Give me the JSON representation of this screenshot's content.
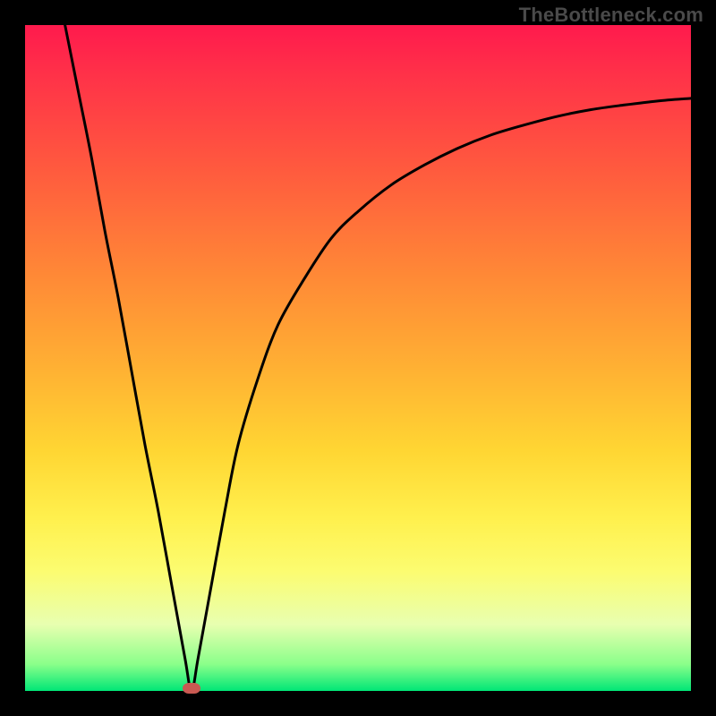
{
  "watermark": "TheBottleneck.com",
  "chart_data": {
    "type": "line",
    "title": "",
    "xlabel": "",
    "ylabel": "",
    "xlim": [
      0,
      100
    ],
    "ylim": [
      0,
      100
    ],
    "x": [
      6,
      8,
      10,
      12,
      14,
      16,
      18,
      20,
      22,
      24,
      25,
      26,
      28,
      30,
      32,
      35,
      38,
      42,
      46,
      50,
      55,
      60,
      65,
      70,
      75,
      80,
      85,
      90,
      95,
      100
    ],
    "values": [
      100,
      90,
      80,
      69,
      59,
      48,
      37,
      27,
      16,
      5,
      0,
      5,
      16,
      27,
      37,
      47,
      55,
      62,
      68,
      72,
      76,
      79,
      81.5,
      83.5,
      85,
      86.3,
      87.3,
      88,
      88.6,
      89
    ],
    "annotations": [
      {
        "type": "marker",
        "x": 25,
        "y": 0,
        "label": ""
      }
    ],
    "grid": false
  },
  "colors": {
    "curve": "#000000",
    "marker": "#c95a52",
    "frame": "#000000"
  }
}
